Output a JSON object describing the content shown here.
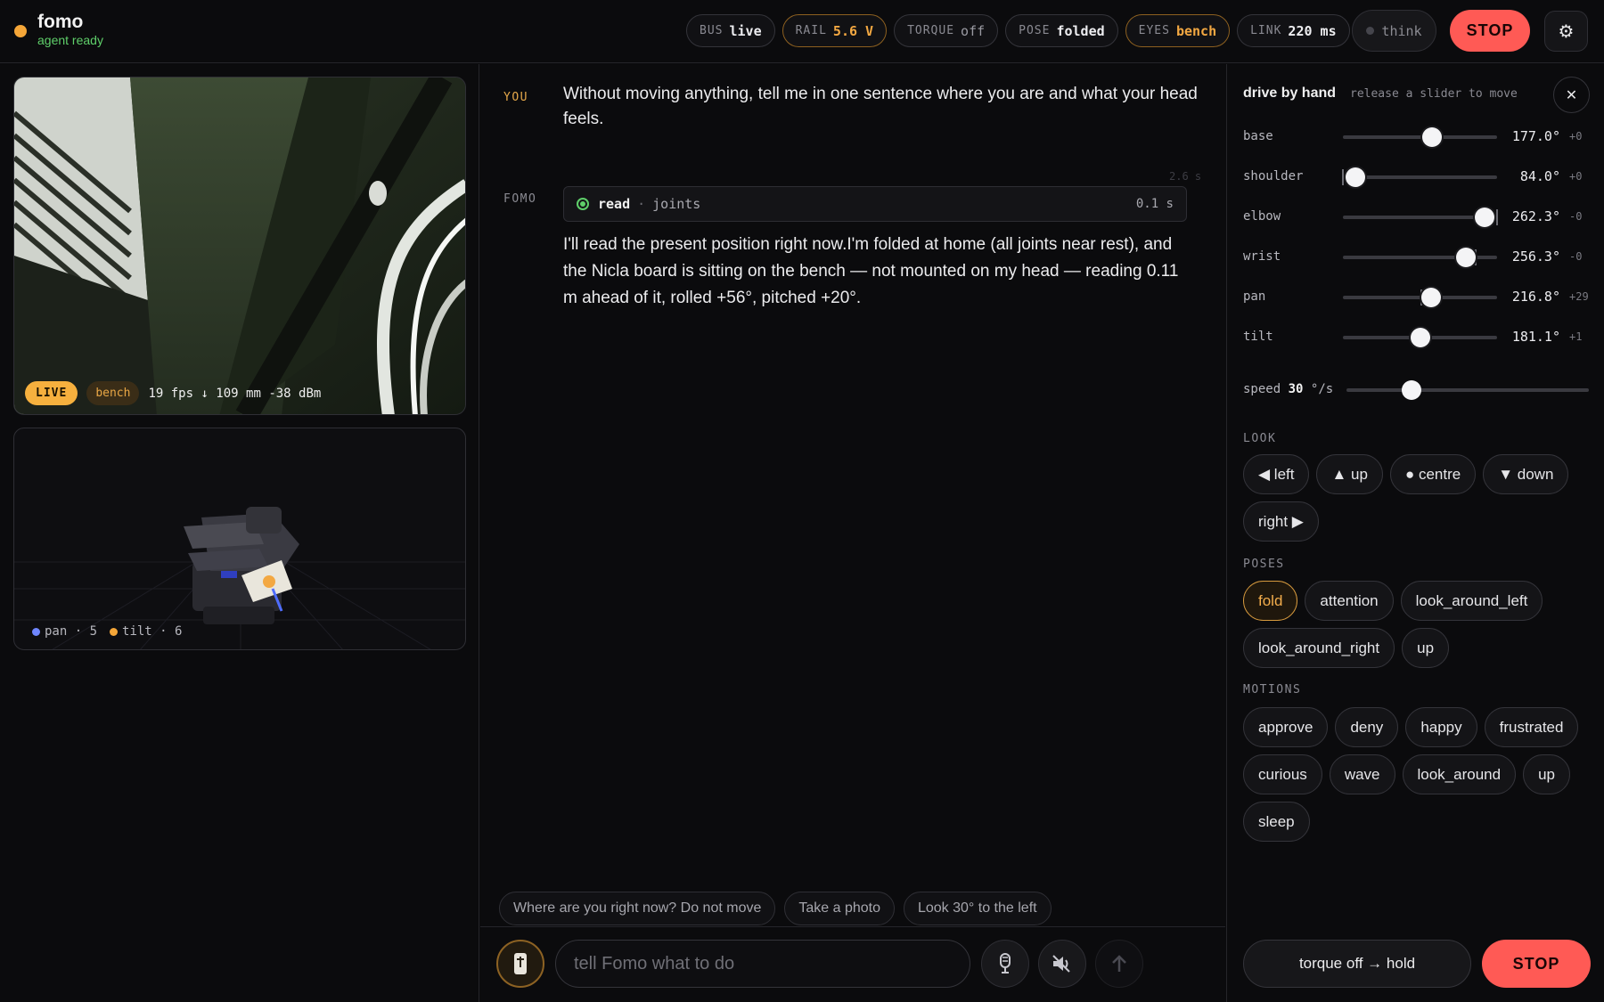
{
  "header": {
    "app_name": "fomo",
    "status": "agent ready",
    "chips": [
      {
        "key": "BUS",
        "value": "live",
        "state": "normal"
      },
      {
        "key": "RAIL",
        "value": "5.6 V",
        "state": "warn"
      },
      {
        "key": "TORQUE",
        "value": "off",
        "state": "muted"
      },
      {
        "key": "POSE",
        "value": "folded",
        "state": "normal"
      },
      {
        "key": "EYES",
        "value": "bench",
        "state": "warn"
      },
      {
        "key": "LINK",
        "value": "220 ms",
        "state": "normal"
      }
    ],
    "think_label": "think",
    "stop_label": "STOP",
    "settings_icon": "gear-icon"
  },
  "camera": {
    "live_label": "LIVE",
    "bench_label": "bench",
    "stats": "19 fps ↓ 109 mm -38 dBm"
  },
  "sim": {
    "legend": [
      {
        "label": "pan · 5",
        "color": "#6f86ff"
      },
      {
        "label": "tilt · 6",
        "color": "#f5a638"
      }
    ]
  },
  "chat": {
    "you_role": "YOU",
    "fomo_role": "FOMO",
    "user_message": "Without moving anything, tell me in one sentence where you are and what your head feels.",
    "elapsed": "2.6 s",
    "tool": {
      "name": "read",
      "arg": "joints",
      "duration": "0.1 s"
    },
    "reply": "I'll read the present position right now.I'm folded at home (all joints near rest), and the Nicla board is sitting on the bench — not mounted on my head — reading 0.11 m ahead of it, rolled +56°, pitched +20°.",
    "suggestions": [
      "Where are you right now? Do not move",
      "Take a photo",
      "Look 30° to the left"
    ],
    "input_placeholder": "tell Fomo what to do"
  },
  "drive": {
    "title": "drive by hand",
    "subtitle": "release a slider to move",
    "joints": [
      {
        "name": "base",
        "value": "177.0°",
        "delta": "+0",
        "fraction": 0.58,
        "tick": 0.58
      },
      {
        "name": "shoulder",
        "value": "84.0°",
        "delta": "+0",
        "fraction": 0.08,
        "tick": 0.0
      },
      {
        "name": "elbow",
        "value": "262.3°",
        "delta": "-0",
        "fraction": 0.92,
        "tick": 1.0
      },
      {
        "name": "wrist",
        "value": "256.3°",
        "delta": "-0",
        "fraction": 0.8,
        "tick": 0.86
      },
      {
        "name": "pan",
        "value": "216.8°",
        "delta": "+29",
        "fraction": 0.57,
        "tick": 0.51
      },
      {
        "name": "tilt",
        "value": "181.1°",
        "delta": "+1",
        "fraction": 0.5,
        "tick": 0.5
      }
    ],
    "speed_label": "speed",
    "speed_value": "30",
    "speed_unit": "°/s",
    "speed_fraction": 0.27,
    "look_title": "LOOK",
    "look": [
      "◀ left",
      "▲ up",
      "● centre",
      "▼ down",
      "right ▶"
    ],
    "poses_title": "POSES",
    "poses": [
      "fold",
      "attention",
      "look_around_left",
      "look_around_right",
      "up"
    ],
    "active_pose": "fold",
    "motions_title": "MOTIONS",
    "motions": [
      "approve",
      "deny",
      "happy",
      "frustrated",
      "curious",
      "wave",
      "look_around",
      "up",
      "sleep"
    ],
    "torque_label": "torque off → hold",
    "stop_label": "STOP"
  }
}
